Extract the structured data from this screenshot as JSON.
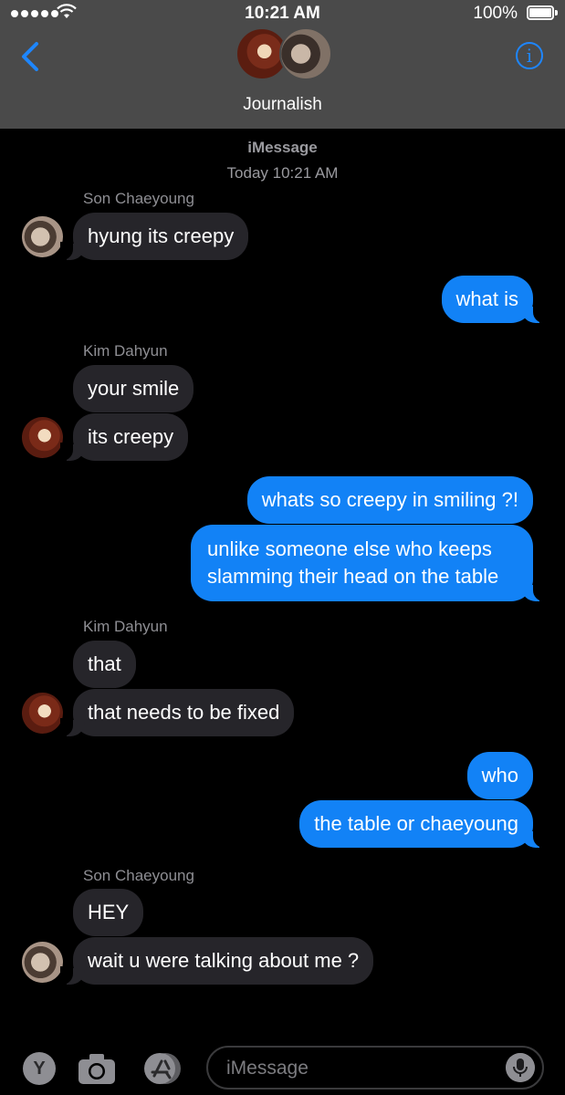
{
  "status_bar": {
    "time": "10:21 AM",
    "battery": "100%"
  },
  "header": {
    "group_name": "Journalish",
    "info_glyph": "i"
  },
  "thread": {
    "service": "iMessage",
    "date": "Today 10:21 AM"
  },
  "messages": [
    {
      "sender": "Son Chaeyoung",
      "dir": "in",
      "text": "hyung its creepy"
    },
    {
      "dir": "out",
      "text": "what is"
    },
    {
      "sender": "Kim Dahyun",
      "dir": "in",
      "text": "your smile"
    },
    {
      "dir": "in",
      "text": "its creepy"
    },
    {
      "dir": "out",
      "text": "whats so creepy in smiling ?!"
    },
    {
      "dir": "out",
      "text": "unlike someone else who keeps slamming their head on the table"
    },
    {
      "sender": "Kim Dahyun",
      "dir": "in",
      "text": "that"
    },
    {
      "dir": "in",
      "text": "that needs to be fixed"
    },
    {
      "dir": "out",
      "text": "who"
    },
    {
      "dir": "out",
      "text": "the table or chaeyoung"
    },
    {
      "sender": "Son Chaeyoung",
      "dir": "in",
      "text": "HEY"
    },
    {
      "dir": "in",
      "text": "wait u were talking about me ?"
    }
  ],
  "input_bar": {
    "y_button": "Y",
    "placeholder": "iMessage"
  },
  "colors": {
    "header_bg": "#4a4a4a",
    "accent": "#1e86ff",
    "outgoing": "#1282f6",
    "incoming": "#26252a"
  },
  "icons": [
    "back-chevron-icon",
    "info-icon",
    "camera-icon",
    "app-store-icon",
    "microphone-icon",
    "wifi-icon",
    "battery-icon"
  ]
}
